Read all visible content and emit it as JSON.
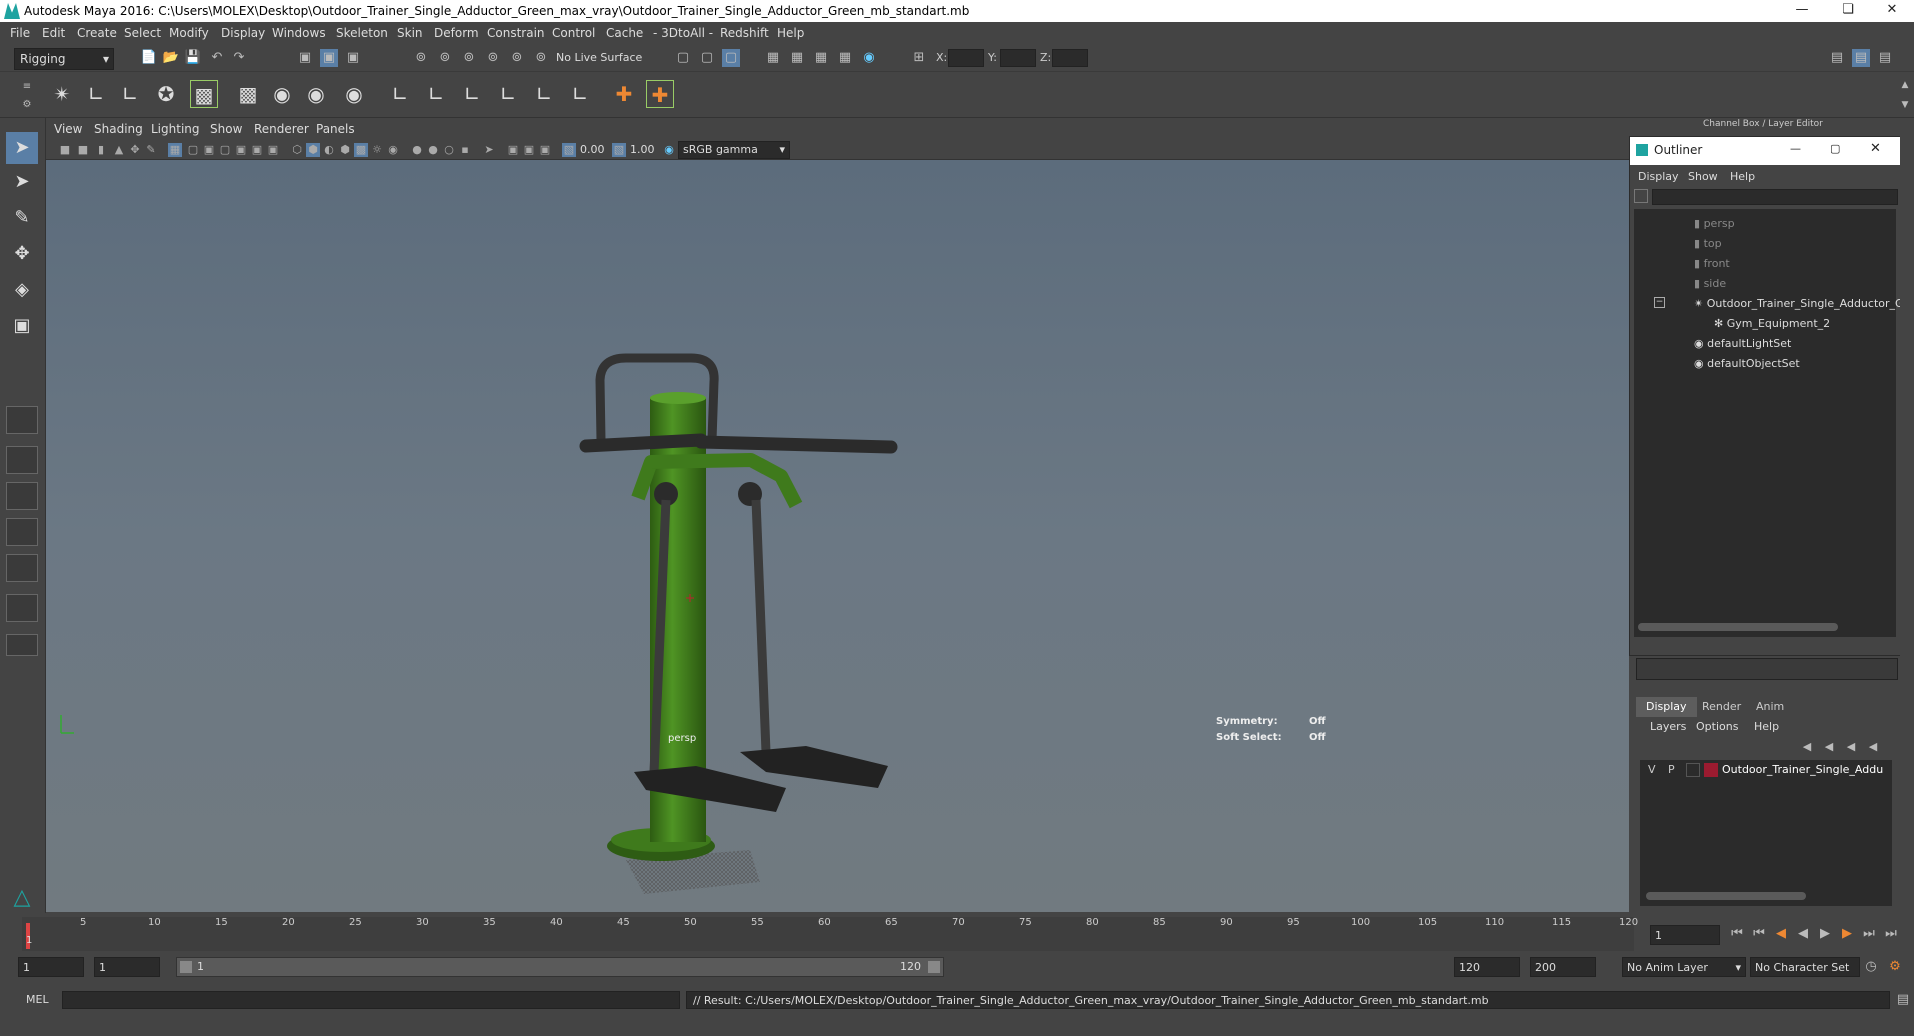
{
  "window": {
    "title": "Autodesk Maya 2016: C:\\Users\\MOLEX\\Desktop\\Outdoor_Trainer_Single_Adductor_Green_max_vray\\Outdoor_Trainer_Single_Adductor_Green_mb_standart.mb"
  },
  "menubar": [
    "File",
    "Edit",
    "Create",
    "Select",
    "Modify",
    "Display",
    "Windows",
    "Skeleton",
    "Skin",
    "Deform",
    "Constrain",
    "Control",
    "Cache",
    "- 3DtoAll -",
    "Redshift",
    "Help"
  ],
  "status": {
    "mode": "Rigging",
    "live_surface": "No Live Surface",
    "x_label": "X:",
    "y_label": "Y:",
    "z_label": "Z:"
  },
  "viewport": {
    "menu": [
      "View",
      "Shading",
      "Lighting",
      "Show",
      "Renderer",
      "Panels"
    ],
    "exposure": "0.00",
    "gamma": "1.00",
    "color_space": "sRGB gamma",
    "camera_label": "persp",
    "symmetry_label": "Symmetry:",
    "symmetry_value": "Off",
    "soft_select_label": "Soft Select:",
    "soft_select_value": "Off"
  },
  "channel_box_title": "Channel Box / Layer Editor",
  "outliner": {
    "title": "Outliner",
    "menu": [
      "Display",
      "Show",
      "Help"
    ],
    "items": [
      {
        "label": "persp",
        "icon": "camera-icon",
        "dim": true
      },
      {
        "label": "top",
        "icon": "camera-icon",
        "dim": true
      },
      {
        "label": "front",
        "icon": "camera-icon",
        "dim": true
      },
      {
        "label": "side",
        "icon": "camera-icon",
        "dim": true
      },
      {
        "label": "Outdoor_Trainer_Single_Adductor_Gre",
        "icon": "group-icon",
        "dim": false
      },
      {
        "label": "Gym_Equipment_2",
        "icon": "mesh-icon",
        "dim": false
      },
      {
        "label": "defaultLightSet",
        "icon": "set-icon",
        "dim": false
      },
      {
        "label": "defaultObjectSet",
        "icon": "set-icon",
        "dim": false
      }
    ]
  },
  "layer_editor": {
    "tabs": [
      "Display",
      "Render",
      "Anim"
    ],
    "menu": [
      "Layers",
      "Options",
      "Help"
    ],
    "layer": {
      "v": "V",
      "p": "P",
      "name": "Outdoor_Trainer_Single_Addu",
      "color": "#9b1b30"
    }
  },
  "timeline": {
    "ticks": [
      "1",
      "5",
      "10",
      "15",
      "20",
      "25",
      "30",
      "35",
      "40",
      "45",
      "50",
      "55",
      "60",
      "65",
      "70",
      "75",
      "80",
      "85",
      "90",
      "95",
      "100",
      "105",
      "110",
      "115",
      "120"
    ],
    "current_frame": "1"
  },
  "range": {
    "start": "1",
    "playback_start": "1",
    "slider_start": "1",
    "slider_end": "120",
    "playback_end": "120",
    "end": "200",
    "anim_layer": "No Anim Layer",
    "character_set": "No Character Set"
  },
  "command": {
    "lang": "MEL",
    "result": "// Result: C:/Users/MOLEX/Desktop/Outdoor_Trainer_Single_Adductor_Green_max_vray/Outdoor_Trainer_Single_Adductor_Green_mb_standart.mb"
  },
  "colors": {
    "green": "#3f7a1c",
    "dark": "#2a2a2a",
    "accent": "#1ea3a0"
  }
}
